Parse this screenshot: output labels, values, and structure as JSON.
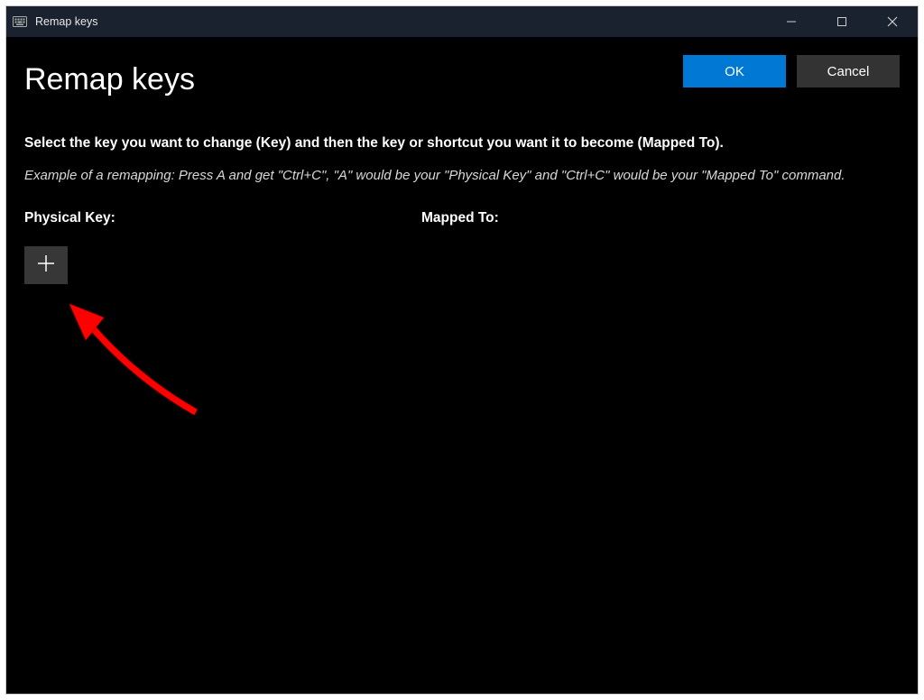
{
  "titlebar": {
    "title": "Remap keys"
  },
  "header": {
    "page_title": "Remap keys",
    "ok_label": "OK",
    "cancel_label": "Cancel"
  },
  "body": {
    "instruction": "Select the key you want to change (Key) and then the key or shortcut you want it to become (Mapped To).",
    "example": "Example of a remapping: Press A and get \"Ctrl+C\", \"A\" would be your \"Physical Key\" and \"Ctrl+C\" would be your \"Mapped To\" command.",
    "physical_key_label": "Physical Key:",
    "mapped_to_label": "Mapped To:"
  },
  "colors": {
    "accent": "#0078d4",
    "titlebar_bg": "#1a2230",
    "button_secondary_bg": "#333333",
    "add_btn_bg": "#373737",
    "annotation_arrow": "#ff0000"
  }
}
